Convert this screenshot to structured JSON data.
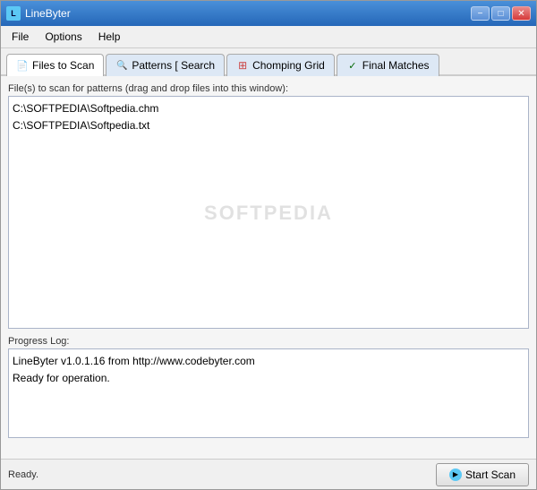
{
  "window": {
    "title": "LineByter",
    "controls": {
      "minimize": "−",
      "maximize": "□",
      "close": "✕"
    }
  },
  "menu": {
    "items": [
      {
        "id": "file",
        "label": "File"
      },
      {
        "id": "options",
        "label": "Options"
      },
      {
        "id": "help",
        "label": "Help"
      }
    ]
  },
  "tabs": [
    {
      "id": "files-to-scan",
      "label": "Files to Scan",
      "active": true
    },
    {
      "id": "patterns-to-search",
      "label": "Patterns [ Search"
    },
    {
      "id": "chomping-grid",
      "label": "Chomping Grid"
    },
    {
      "id": "final-matches",
      "label": "Final Matches"
    }
  ],
  "main": {
    "files_section": {
      "label": "File(s) to scan for patterns (drag and drop files into this window):",
      "files": [
        "C:\\SOFTPEDIA\\Softpedia.chm",
        "C:\\SOFTPEDIA\\Softpedia.txt"
      ]
    },
    "progress_section": {
      "label": "Progress Log:",
      "entries": [
        "LineByter v1.0.1.16 from http://www.codebyter.com",
        "Ready for operation."
      ]
    }
  },
  "status": {
    "text": "Ready.",
    "start_scan_label": "Start Scan"
  },
  "watermark": "SOFTPEDIA"
}
